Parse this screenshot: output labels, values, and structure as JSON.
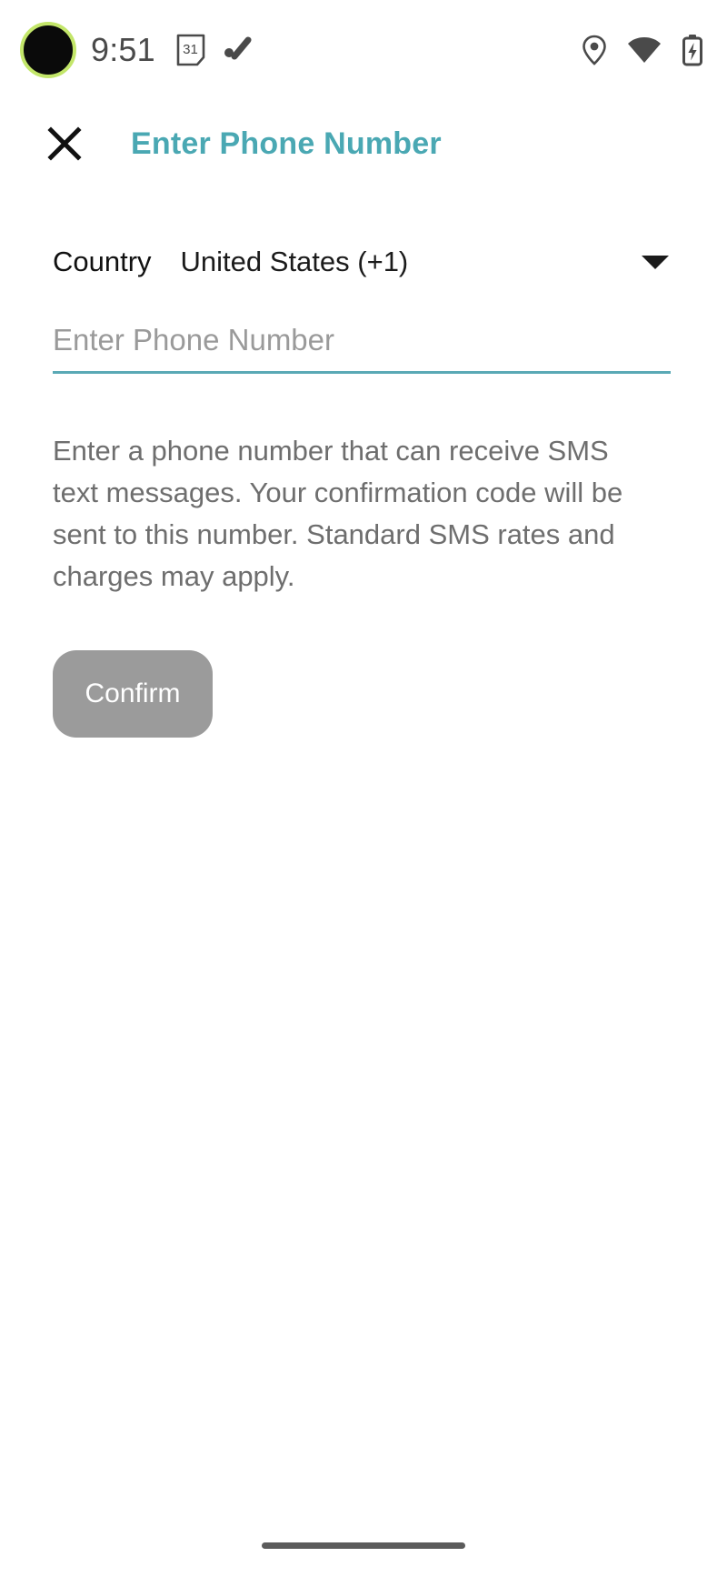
{
  "status_bar": {
    "time": "9:51",
    "camera_punch_hole": "camera-punch-hole",
    "left_icons": [
      {
        "name": "calendar-icon",
        "label": "31"
      },
      {
        "name": "edit-pen-icon",
        "label": ""
      }
    ],
    "right_icons": [
      {
        "name": "location-pin-icon",
        "label": ""
      },
      {
        "name": "wifi-icon",
        "label": ""
      },
      {
        "name": "battery-charging-icon",
        "label": ""
      }
    ],
    "colors": {
      "punch_ring": "#c3e66a",
      "icon": "#4a4a4a"
    }
  },
  "app_bar": {
    "close_icon": "close-icon",
    "title": "Enter Phone Number",
    "title_color": "#4aa8b3"
  },
  "form": {
    "country_label": "Country",
    "country_value": "United States (+1)",
    "country_dropdown_icon": "chevron-down-icon",
    "phone_value": "",
    "phone_placeholder": "Enter Phone Number",
    "underline_color": "#5aa9b5"
  },
  "help": {
    "text": "Enter a phone number that can receive SMS text messages. Your confirmation code will be sent to this number. Standard SMS rates and charges may apply."
  },
  "actions": {
    "confirm_label": "Confirm",
    "confirm_bg": "#9b9b9b",
    "confirm_text_color": "#ffffff"
  },
  "nav_bar": {
    "gesture_pill": "gesture-nav-pill"
  }
}
